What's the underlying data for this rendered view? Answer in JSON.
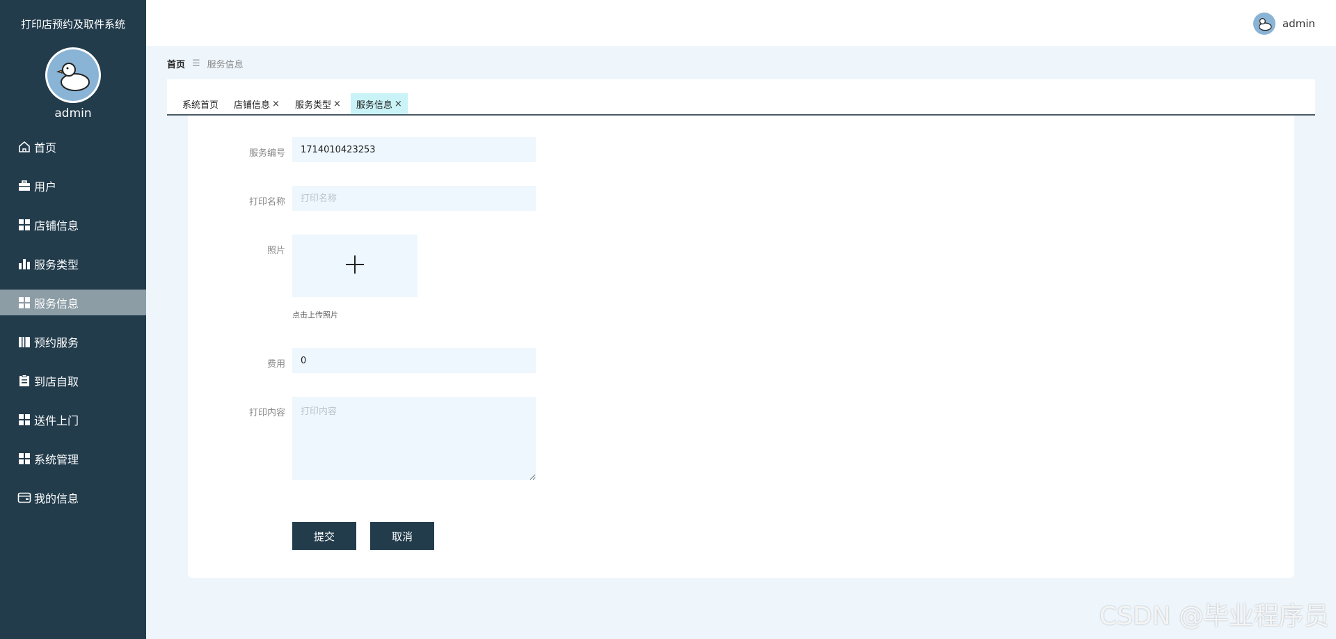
{
  "app": {
    "title": "打印店预约及取件系统",
    "username": "admin"
  },
  "sidebar": {
    "items": [
      {
        "label": "首页",
        "icon": "home-icon"
      },
      {
        "label": "用户",
        "icon": "briefcase-icon"
      },
      {
        "label": "店铺信息",
        "icon": "grid-icon"
      },
      {
        "label": "服务类型",
        "icon": "bar-chart-icon"
      },
      {
        "label": "服务信息",
        "icon": "grid-icon",
        "active": true
      },
      {
        "label": "预约服务",
        "icon": "book-icon"
      },
      {
        "label": "到店自取",
        "icon": "clipboard-icon"
      },
      {
        "label": "送件上门",
        "icon": "grid-icon"
      },
      {
        "label": "系统管理",
        "icon": "grid-icon"
      },
      {
        "label": "我的信息",
        "icon": "wallet-icon"
      }
    ]
  },
  "topbar": {
    "username": "admin"
  },
  "breadcrumb": {
    "home": "首页",
    "separator": "☰",
    "current": "服务信息"
  },
  "tabs": [
    {
      "label": "系统首页",
      "closable": false
    },
    {
      "label": "店铺信息",
      "closable": true
    },
    {
      "label": "服务类型",
      "closable": true
    },
    {
      "label": "服务信息",
      "closable": true,
      "active": true
    }
  ],
  "form": {
    "service_no": {
      "label": "服务编号",
      "value": "1714010423253"
    },
    "print_name": {
      "label": "打印名称",
      "value": "",
      "placeholder": "打印名称"
    },
    "photo": {
      "label": "照片",
      "hint": "点击上传照片"
    },
    "fee": {
      "label": "费用",
      "value": "0"
    },
    "print_content": {
      "label": "打印内容",
      "value": "",
      "placeholder": "打印内容"
    },
    "submit_label": "提交",
    "cancel_label": "取消"
  },
  "watermark": "CSDN @毕业程序员",
  "colors": {
    "sidebar": "#223c4c",
    "active_menu": "#8c9da6",
    "active_tab": "#c9f3f7",
    "input_bg": "#eef7fd",
    "page_bg": "#eef6fc"
  }
}
